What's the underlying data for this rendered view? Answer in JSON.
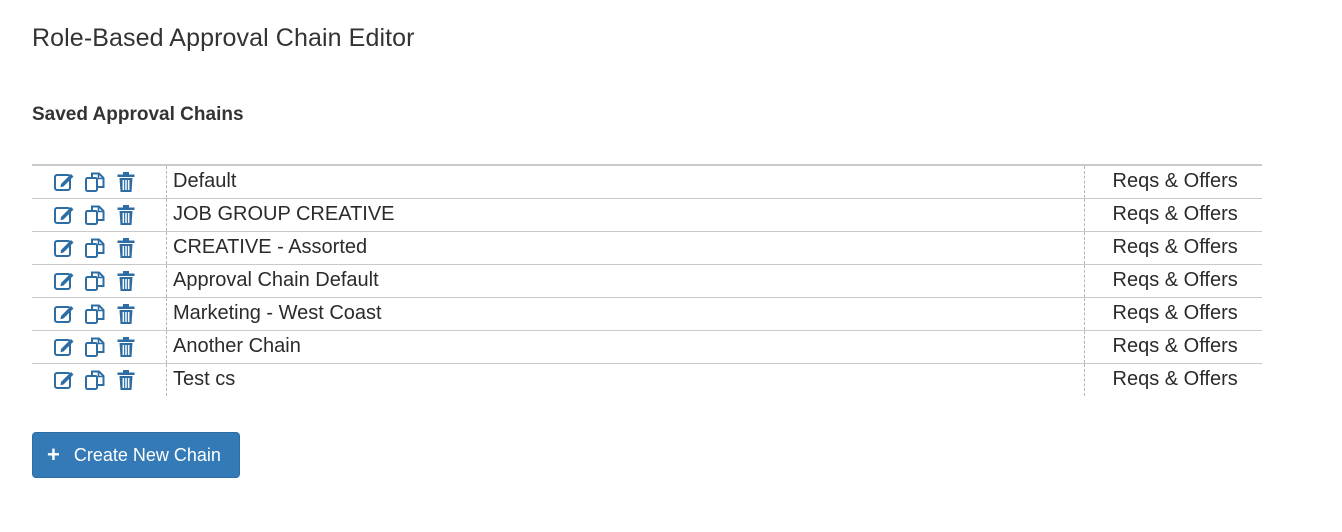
{
  "page": {
    "title": "Role-Based Approval Chain Editor",
    "section_title": "Saved Approval Chains"
  },
  "chains": [
    {
      "name": "Default",
      "type": "Reqs & Offers"
    },
    {
      "name": "JOB GROUP CREATIVE",
      "type": "Reqs & Offers"
    },
    {
      "name": "CREATIVE - Assorted",
      "type": "Reqs & Offers"
    },
    {
      "name": "Approval Chain Default",
      "type": "Reqs & Offers"
    },
    {
      "name": "Marketing - West Coast",
      "type": "Reqs & Offers"
    },
    {
      "name": "Another Chain",
      "type": "Reqs & Offers"
    },
    {
      "name": "Test cs",
      "type": "Reqs & Offers"
    }
  ],
  "row_icons": [
    "edit-icon",
    "copy-icon",
    "trash-icon"
  ],
  "create_button": {
    "icon": "plus-icon",
    "label": "Create New Chain"
  },
  "colors": {
    "icon": "#2e6da4",
    "button_bg": "#337ab7",
    "border": "#c9c9c9"
  }
}
